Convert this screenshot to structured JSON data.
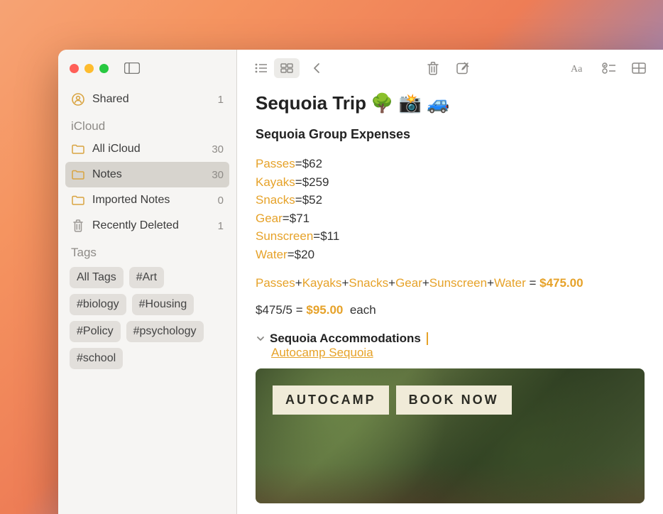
{
  "sidebar": {
    "shared": {
      "label": "Shared",
      "count": "1"
    },
    "section1": "iCloud",
    "folders": [
      {
        "label": "All iCloud",
        "count": "30"
      },
      {
        "label": "Notes",
        "count": "30"
      },
      {
        "label": "Imported Notes",
        "count": "0"
      },
      {
        "label": "Recently Deleted",
        "count": "1"
      }
    ],
    "section2": "Tags",
    "tags": [
      "All Tags",
      "#Art",
      "#biology",
      "#Housing",
      "#Policy",
      "#psychology",
      "#school"
    ]
  },
  "note": {
    "title": "Sequoia Trip",
    "title_emoji": "🌳 📸 🚙",
    "subheading": "Sequoia Group Expenses",
    "expenses": [
      {
        "name": "Passes",
        "value": "$62"
      },
      {
        "name": "Kayaks",
        "value": "$259"
      },
      {
        "name": "Snacks",
        "value": "$52"
      },
      {
        "name": "Gear",
        "value": "$71"
      },
      {
        "name": "Sunscreen",
        "value": "$11"
      },
      {
        "name": "Water",
        "value": "$20"
      }
    ],
    "formula_parts": [
      "Passes",
      "Kayaks",
      "Snacks",
      "Gear",
      "Sunscreen",
      "Water"
    ],
    "formula_total": "$475.00",
    "split_left": "$475/5",
    "split_val": "$95.00",
    "split_suffix": "each",
    "section_header": "Sequoia Accommodations",
    "link_text": "Autocamp Sequoia",
    "image_btn1": "AUTOCAMP",
    "image_btn2": "BOOK NOW"
  }
}
